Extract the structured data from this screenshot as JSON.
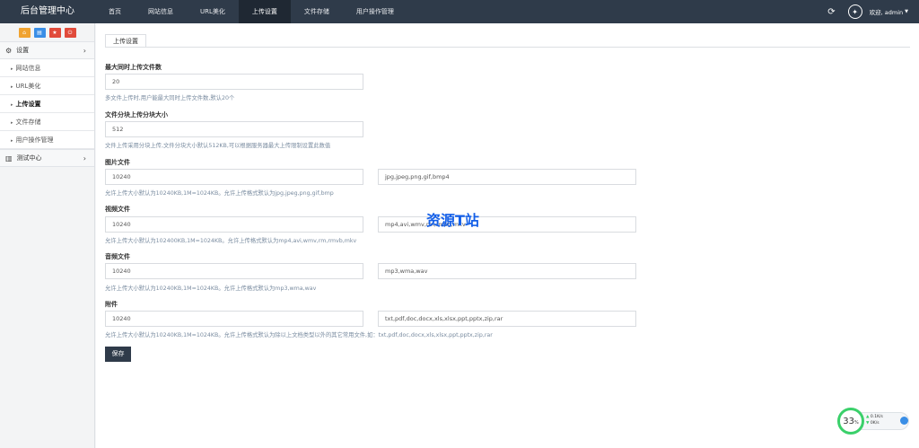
{
  "header": {
    "brand": "后台管理中心",
    "nav": [
      {
        "label": "首页"
      },
      {
        "label": "网站信息"
      },
      {
        "label": "URL美化"
      },
      {
        "label": "上传设置"
      },
      {
        "label": "文件存储"
      },
      {
        "label": "用户操作管理"
      }
    ],
    "active_nav": "上传设置",
    "welcome": "欢迎, admin",
    "icons": {
      "refresh": "refresh-icon",
      "avatar": "avatar-icon",
      "caret": "caret-down-icon"
    }
  },
  "sidebar": {
    "shortcuts": [
      "home-icon",
      "file-icon",
      "star-icon",
      "power-icon"
    ],
    "groups": [
      {
        "label": "设置",
        "icon": "gears-icon",
        "expanded": true
      },
      {
        "label": "测试中心",
        "icon": "book-icon",
        "expanded": false
      }
    ],
    "items": [
      {
        "label": "网站信息"
      },
      {
        "label": "URL美化"
      },
      {
        "label": "上传设置",
        "active": true
      },
      {
        "label": "文件存储"
      },
      {
        "label": "用户操作管理"
      }
    ]
  },
  "main": {
    "tab": "上传设置",
    "fields": {
      "max_files": {
        "label": "最大同时上传文件数",
        "value": "20",
        "help": "多文件上传时,用户能最大同时上传文件数,默认20个"
      },
      "chunk": {
        "label": "文件分块上传分块大小",
        "value": "512",
        "help": "文件上传采用分块上传,文件分块大小默认512KB,可以根据服务器最大上传限制设置此数值"
      },
      "image": {
        "label": "图片文件",
        "size": "10240",
        "types": "jpg,jpeg,png,gif,bmp4",
        "help": "允许上传大小默认为10240KB,1M=1024KB。允许上传格式默认为jpg,jpeg,png,gif,bmp"
      },
      "video": {
        "label": "视频文件",
        "size": "10240",
        "types": "mp4,avi,wmv,rm,rmvb,mkv",
        "help": "允许上传大小默认为102400KB,1M=1024KB。允许上传格式默认为mp4,avi,wmv,rm,rmvb,mkv"
      },
      "audio": {
        "label": "音频文件",
        "size": "10240",
        "types": "mp3,wma,wav",
        "help": "允许上传大小默认为10240KB,1M=1024KB。允许上传格式默认为mp3,wma,wav"
      },
      "attach": {
        "label": "附件",
        "size": "10240",
        "types": "txt,pdf,doc,docx,xls,xlsx,ppt,pptx,zip,rar",
        "help": "允许上传大小默认为10240KB,1M=1024KB。允许上传格式默认为除以上文档类型以外的其它常用文件,如：txt,pdf,doc,docx,xls,xlsx,ppt,pptx,zip,rar"
      }
    },
    "save_label": "保存"
  },
  "watermark": "资源T站",
  "speed_widget": {
    "percent": "33",
    "percent_unit": "%",
    "up": "0.1K/s",
    "down": "0K/s"
  },
  "colors": {
    "topbar": "#2f3b4a",
    "active_nav": "#1f2833",
    "help_text": "#7a8ca0",
    "accent_green": "#3ad06a"
  }
}
